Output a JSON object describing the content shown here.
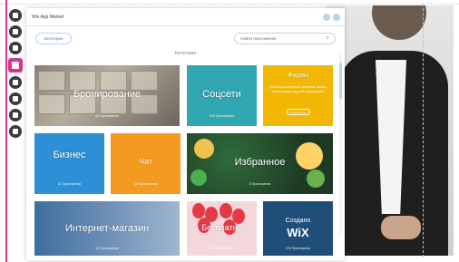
{
  "window": {
    "title": "Wix App Market"
  },
  "header": {
    "search_button": "Категории"
  },
  "search": {
    "placeholder": "Найти приложение"
  },
  "section": {
    "label": "Категории"
  },
  "tiles": [
    {
      "name": "Бронирование",
      "count": "64 Приложения",
      "color": "#8a7f73"
    },
    {
      "name": "Соцсети",
      "count": "108 Приложения",
      "color": "#2fa6b0"
    },
    {
      "name": "Формы",
      "desc": "Для сбора контактов, запросов, заявок, регистрации и другой информации",
      "button": "Приложения",
      "color": "#f2b705"
    },
    {
      "name": "Бизнес",
      "count": "51 Приложения",
      "color": "#2d8fd5"
    },
    {
      "name": "Чат",
      "count": "11 Приложения",
      "color": "#f49a20"
    },
    {
      "name": "Избранное",
      "count": "8 Приложения",
      "color": "#1e3a24"
    },
    {
      "name": "Интернет-магазин",
      "count": "53 Приложения",
      "color": "#3f6f9e"
    },
    {
      "name": "Бесплатно",
      "count": "46 Приложения",
      "color": "#e63946"
    },
    {
      "name_line1": "Создано",
      "name_line2": "WiX",
      "count": "100 Приложения",
      "color": "#1f4e79"
    }
  ],
  "colors": {
    "accent": "#d4378a",
    "link": "#4e87c8"
  },
  "toolbar": {
    "icons": [
      "pages-icon",
      "background-icon",
      "add-icon",
      "app-market-icon",
      "upload-icon",
      "publish-icon",
      "bag-icon",
      "blog-icon"
    ]
  }
}
